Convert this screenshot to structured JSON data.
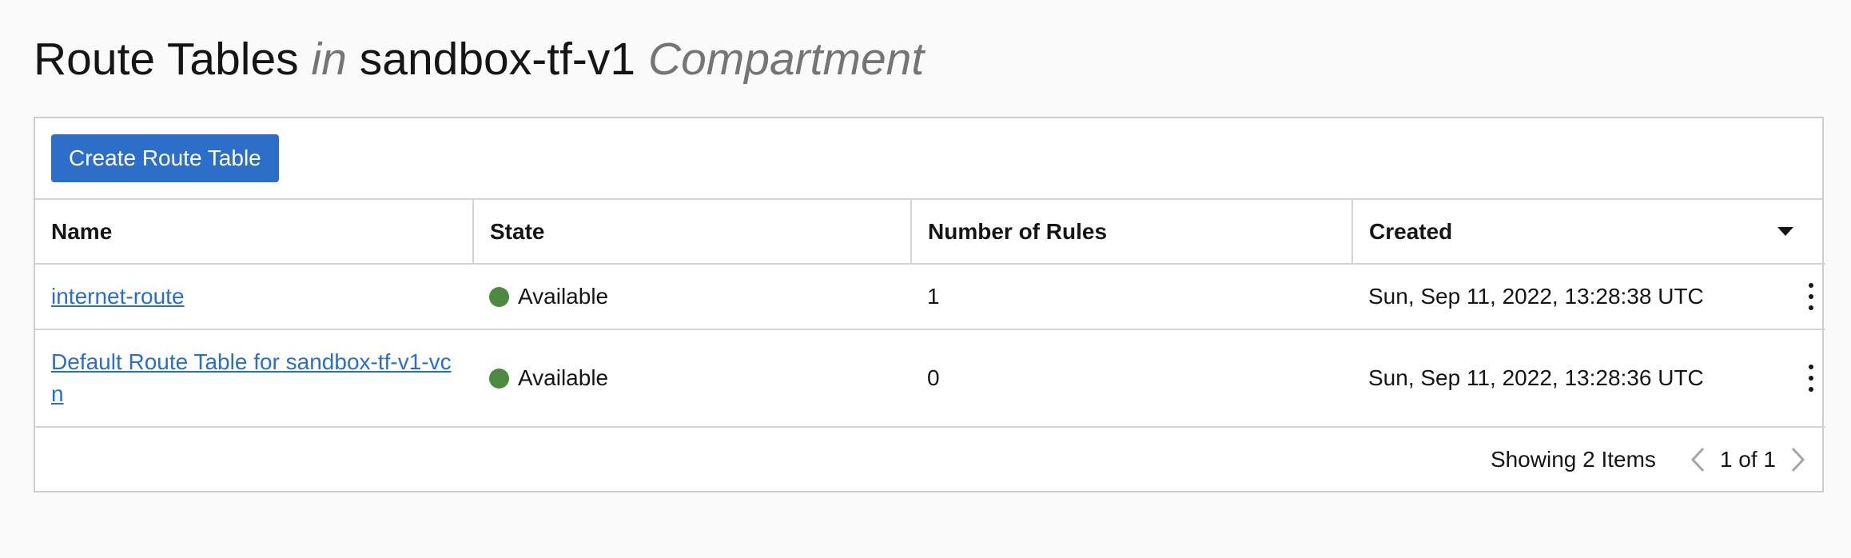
{
  "header": {
    "title_prefix": "Route Tables",
    "title_in": "in",
    "compartment_name": "sandbox-tf-v1",
    "title_suffix": "Compartment"
  },
  "toolbar": {
    "create_label": "Create Route Table"
  },
  "table": {
    "columns": [
      "Name",
      "State",
      "Number of Rules",
      "Created"
    ],
    "rows": [
      {
        "name": "internet-route",
        "state": "Available",
        "rules": "1",
        "created": "Sun, Sep 11, 2022, 13:28:38 UTC"
      },
      {
        "name": "Default Route Table for sandbox-tf-v1-vcn",
        "state": "Available",
        "rules": "0",
        "created": "Sun, Sep 11, 2022, 13:28:36 UTC"
      }
    ]
  },
  "footer": {
    "showing": "Showing 2 Items",
    "page_label": "1 of 1"
  },
  "colors": {
    "primary_button": "#2d6ec9",
    "link": "#2a6fc6",
    "status_available": "#4d8a41",
    "muted_text": "#767573"
  },
  "icons": {
    "sort": "caret-down-icon",
    "row_actions": "kebab-menu-icon",
    "prev": "chevron-left-icon",
    "next": "chevron-right-icon"
  }
}
